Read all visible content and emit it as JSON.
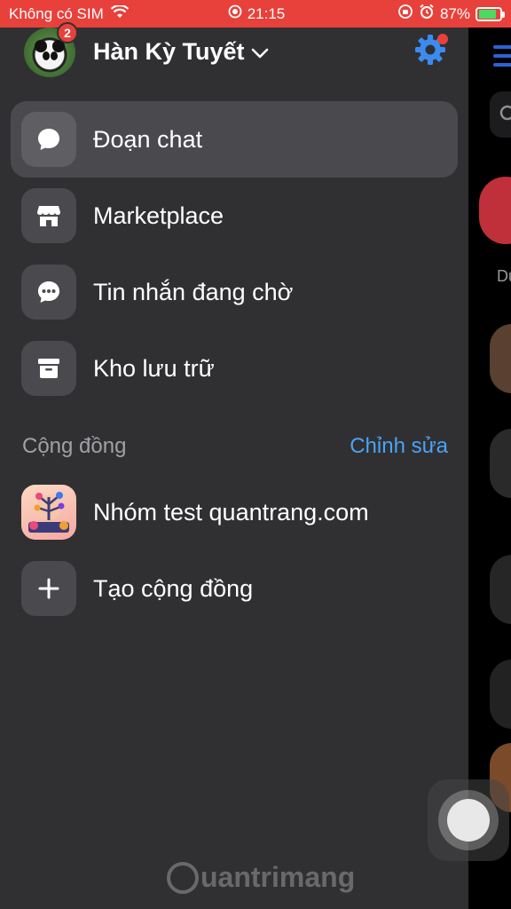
{
  "status_bar": {
    "carrier": "Không có SIM",
    "time": "21:15",
    "battery_percent": "87%",
    "battery_level": 0.87,
    "background_color": "#e8413b"
  },
  "profile": {
    "name": "Hàn Kỳ Tuyết",
    "notification_count": "2"
  },
  "menu": {
    "items": [
      {
        "label": "Đoạn chat",
        "icon": "chat-bubble-icon",
        "active": true
      },
      {
        "label": "Marketplace",
        "icon": "storefront-icon",
        "active": false
      },
      {
        "label": "Tin nhắn đang chờ",
        "icon": "message-pending-icon",
        "active": false
      },
      {
        "label": "Kho lưu trữ",
        "icon": "archive-box-icon",
        "active": false
      }
    ]
  },
  "community": {
    "title": "Cộng đồng",
    "edit_label": "Chỉnh sửa",
    "groups": [
      {
        "label": "Nhóm test quantrang.com",
        "icon": "group-avatar-icon"
      }
    ],
    "create_label": "Tạo cộng đồng"
  },
  "peek": {
    "partial_name": "Du"
  },
  "watermark": "uantrimang",
  "colors": {
    "accent": "#4aa3f5",
    "drawer_bg": "#303033",
    "active_item_bg": "#4a4a4e",
    "badge": "#e8413b"
  }
}
